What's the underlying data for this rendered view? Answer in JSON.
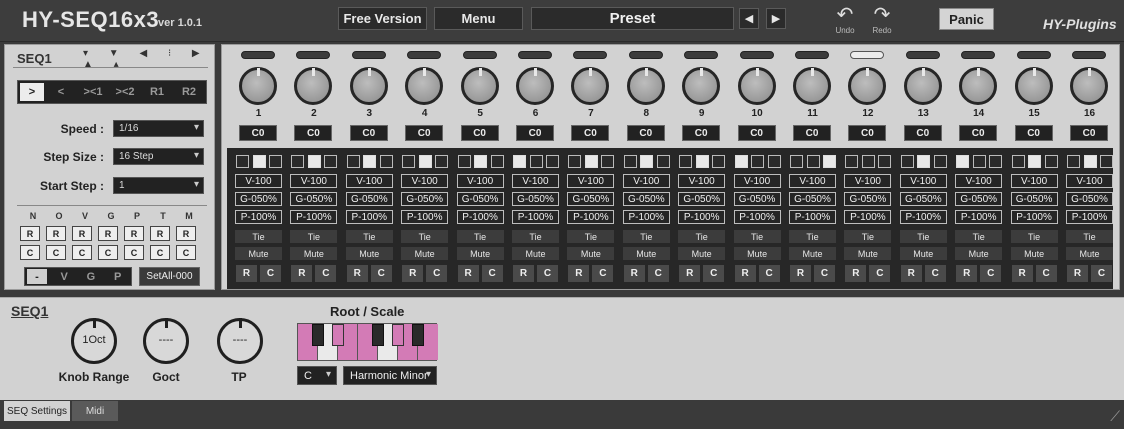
{
  "header": {
    "title": "HY-SEQ16x3",
    "version": "ver 1.0.1",
    "free_version_label": "Free Version",
    "menu_label": "Menu",
    "preset_label": "Preset",
    "prev_icon": "◀",
    "next_icon": "▶",
    "undo_label": "Undo",
    "redo_label": "Redo",
    "panic_label": "Panic",
    "brand": "HY-Plugins"
  },
  "seq_panel": {
    "title": "SEQ1",
    "arrow_icons": "▾ ▼ ◀ ⁝ ▶ ▲ ▴",
    "modes": [
      ">",
      "<",
      "><1",
      "><2",
      "R1",
      "R2"
    ],
    "speed_label": "Speed :",
    "speed_value": "1/16",
    "step_size_label": "Step Size :",
    "step_size_value": "16 Step",
    "start_step_label": "Start Step :",
    "start_step_value": "1",
    "columns": [
      "N",
      "O",
      "V",
      "G",
      "P",
      "T",
      "M"
    ],
    "r_label": "R",
    "c_label": "C",
    "vgp": [
      "-",
      "V",
      "G",
      "P"
    ],
    "setall_label": "SetAll-000"
  },
  "steps": [
    {
      "num": "1",
      "note": "C0",
      "lit": false,
      "sq": [
        0,
        1,
        0
      ]
    },
    {
      "num": "2",
      "note": "C0",
      "lit": false,
      "sq": [
        0,
        1,
        0
      ]
    },
    {
      "num": "3",
      "note": "C0",
      "lit": false,
      "sq": [
        0,
        1,
        0
      ]
    },
    {
      "num": "4",
      "note": "C0",
      "lit": false,
      "sq": [
        0,
        1,
        0
      ]
    },
    {
      "num": "5",
      "note": "C0",
      "lit": false,
      "sq": [
        0,
        1,
        0
      ]
    },
    {
      "num": "6",
      "note": "C0",
      "lit": false,
      "sq": [
        1,
        0,
        0
      ]
    },
    {
      "num": "7",
      "note": "C0",
      "lit": false,
      "sq": [
        0,
        1,
        0
      ]
    },
    {
      "num": "8",
      "note": "C0",
      "lit": false,
      "sq": [
        0,
        1,
        0
      ]
    },
    {
      "num": "9",
      "note": "C0",
      "lit": false,
      "sq": [
        0,
        1,
        0
      ]
    },
    {
      "num": "10",
      "note": "C0",
      "lit": false,
      "sq": [
        1,
        0,
        0
      ]
    },
    {
      "num": "11",
      "note": "C0",
      "lit": false,
      "sq": [
        0,
        0,
        1
      ]
    },
    {
      "num": "12",
      "note": "C0",
      "lit": true,
      "sq": [
        0,
        0,
        0
      ]
    },
    {
      "num": "13",
      "note": "C0",
      "lit": false,
      "sq": [
        0,
        1,
        0
      ]
    },
    {
      "num": "14",
      "note": "C0",
      "lit": false,
      "sq": [
        1,
        0,
        0
      ]
    },
    {
      "num": "15",
      "note": "C0",
      "lit": false,
      "sq": [
        0,
        1,
        0
      ]
    },
    {
      "num": "16",
      "note": "C0",
      "lit": false,
      "sq": [
        0,
        1,
        0
      ]
    }
  ],
  "step_params": {
    "velocity": "V-100",
    "gate": "G-050%",
    "probability": "P-100%",
    "tie": "Tie",
    "mute": "Mute",
    "r": "R",
    "c": "C"
  },
  "bottom": {
    "title": "SEQ1",
    "knob_range_value": "1Oct",
    "knob_range_label": "Knob Range",
    "goct_value": "----",
    "goct_label": "Goct",
    "tp_value": "----",
    "tp_label": "TP",
    "root_scale_label": "Root / Scale",
    "root_value": "C",
    "scale_value": "Harmonic Minor"
  },
  "tabs": [
    "SEQ Settings",
    "Midi"
  ],
  "colors": {
    "scale_key": "#d37bb6",
    "panel": "#d2d2d2",
    "dark": "#272727"
  }
}
